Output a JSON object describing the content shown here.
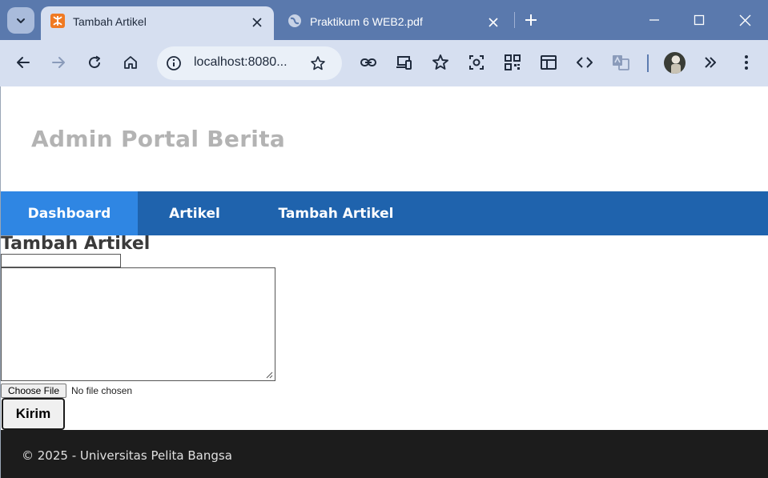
{
  "browser": {
    "tabs": [
      {
        "title": "Tambah Artikel",
        "active": true,
        "favicon": "xampp-icon"
      },
      {
        "title": "Praktikum 6 WEB2.pdf",
        "active": false,
        "favicon": "globe-icon"
      }
    ],
    "address_bar": {
      "url": "localhost:8080..."
    },
    "colors": {
      "tabstrip": "#5a79ad",
      "toolbar": "#d6dff0",
      "active_tab": "#d6dff0"
    }
  },
  "site": {
    "title": "Admin Portal Berita",
    "nav": [
      {
        "label": "Dashboard",
        "active": true
      },
      {
        "label": "Artikel",
        "active": false
      },
      {
        "label": "Tambah Artikel",
        "active": false
      }
    ],
    "colors": {
      "navbar": "#1f63ad",
      "nav_active": "#2f86e3",
      "footer": "#1c1c1c"
    }
  },
  "form": {
    "heading": "Tambah Artikel",
    "title_value": "",
    "content_value": "",
    "file_button": "Choose File",
    "file_status": "No file chosen",
    "submit_label": "Kirim"
  },
  "footer": {
    "text": "© 2025 - Universitas Pelita Bangsa"
  }
}
